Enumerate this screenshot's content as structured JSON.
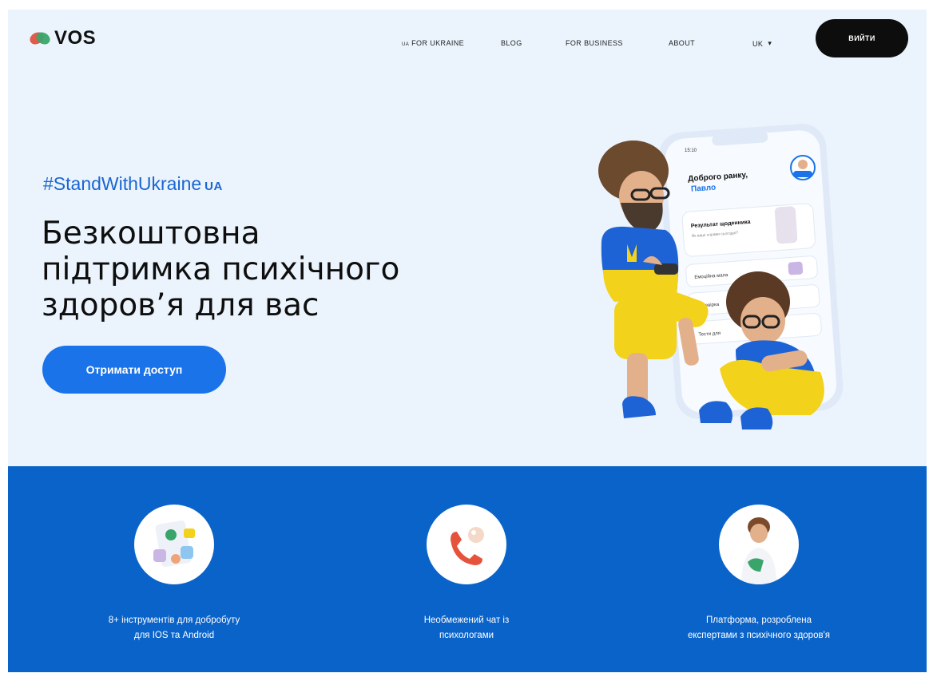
{
  "header": {
    "logo_text": "VOS",
    "nav": [
      {
        "flag": "UA",
        "label": "FOR UKRAINE"
      },
      {
        "label": "BLOG"
      },
      {
        "label": "FOR BUSINESS"
      },
      {
        "label": "ABOUT"
      }
    ],
    "language": {
      "value": "UK",
      "caret": "▾"
    },
    "login_label": "ВИЙТИ"
  },
  "hero": {
    "hashtag": "#StandWithUkraine",
    "hashtag_tag": "UA",
    "headline_lines": [
      "Безкоштовна",
      "підтримка психічного",
      "здоров’я для вас"
    ],
    "cta_label": "Отримати доступ",
    "phone": {
      "time": "15:10",
      "greeting": "Доброго ранку,",
      "name": "Павло",
      "card_title": "Результат щоденника",
      "card_sub": "Як ваші справи сьогодні?",
      "rows": [
        "Емоційна мапа",
        "Перевірка",
        "Тести для"
      ]
    }
  },
  "features": [
    {
      "icon": "wellbeing-tools-icon",
      "lines": [
        "8+ інструментів для добробуту",
        "для IOS та Android"
      ]
    },
    {
      "icon": "phone-chat-icon",
      "lines": [
        "Необмежений чат із",
        "психологами"
      ]
    },
    {
      "icon": "expert-person-icon",
      "lines": [
        "Платформа, розроблена",
        "експертами з психічного здоров'я"
      ]
    }
  ],
  "colors": {
    "hero_bg": "#ebf4fc",
    "accent_blue": "#1a73e8",
    "features_bg": "#0a63c9",
    "login_bg": "#0d0d0d"
  }
}
